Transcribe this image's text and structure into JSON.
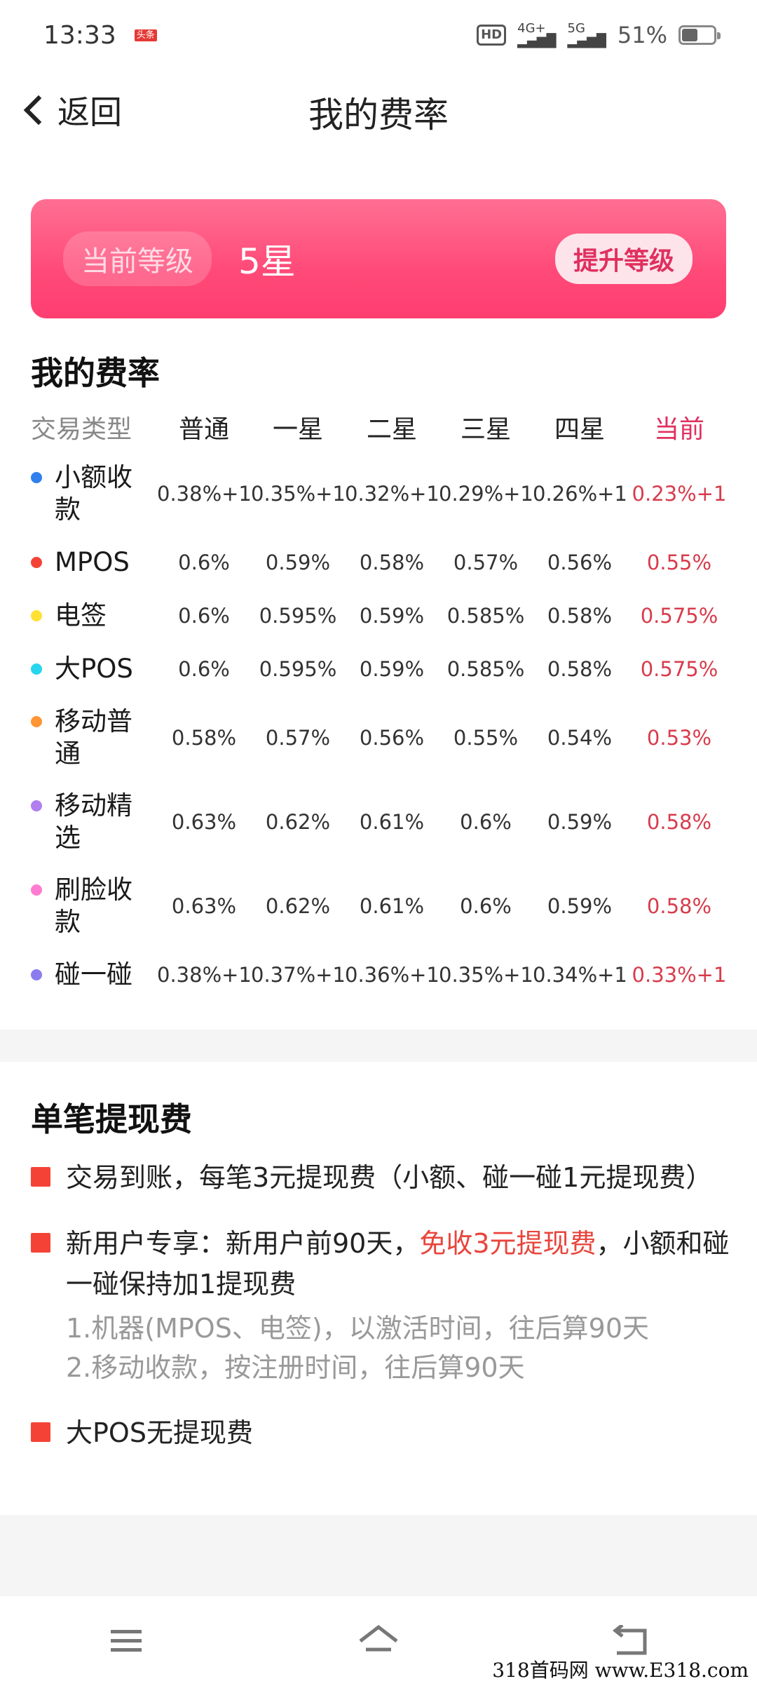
{
  "status_bar": {
    "time": "13:33",
    "news_badge": "头条",
    "network_1": "4G+",
    "network_2": "5G",
    "hd_label": "HD",
    "battery": "51%",
    "battery_level": 0.51
  },
  "nav": {
    "back_label": "返回",
    "title": "我的费率"
  },
  "level_card": {
    "tag_label": "当前等级",
    "level_value": "5星",
    "upgrade_label": "提升等级"
  },
  "rates": {
    "title": "我的费率",
    "headers": [
      "交易类型",
      "普通",
      "一星",
      "二星",
      "三星",
      "四星",
      "当前"
    ],
    "rows": [
      {
        "type": "小额收款",
        "color": "#2f80ed",
        "values": [
          "0.38%+1",
          "0.35%+1",
          "0.32%+1",
          "0.29%+1",
          "0.26%+1"
        ],
        "current": "0.23%+1"
      },
      {
        "type": "MPOS",
        "color": "#f44336",
        "values": [
          "0.6%",
          "0.59%",
          "0.58%",
          "0.57%",
          "0.56%"
        ],
        "current": "0.55%"
      },
      {
        "type": "电签",
        "color": "#ffe034",
        "values": [
          "0.6%",
          "0.595%",
          "0.59%",
          "0.585%",
          "0.58%"
        ],
        "current": "0.575%"
      },
      {
        "type": "大POS",
        "color": "#28d5ee",
        "values": [
          "0.6%",
          "0.595%",
          "0.59%",
          "0.585%",
          "0.58%"
        ],
        "current": "0.575%"
      },
      {
        "type": "移动普通",
        "color": "#ff9533",
        "values": [
          "0.58%",
          "0.57%",
          "0.56%",
          "0.55%",
          "0.54%"
        ],
        "current": "0.53%"
      },
      {
        "type": "移动精选",
        "color": "#b07ff0",
        "values": [
          "0.63%",
          "0.62%",
          "0.61%",
          "0.6%",
          "0.59%"
        ],
        "current": "0.58%"
      },
      {
        "type": "刷脸收款",
        "color": "#ff7bd0",
        "values": [
          "0.63%",
          "0.62%",
          "0.61%",
          "0.6%",
          "0.59%"
        ],
        "current": "0.58%"
      },
      {
        "type": "碰一碰",
        "color": "#8a7cf0",
        "values": [
          "0.38%+1",
          "0.37%+1",
          "0.36%+1",
          "0.35%+1",
          "0.34%+1"
        ],
        "current": "0.33%+1"
      }
    ]
  },
  "withdrawal": {
    "title": "单笔提现费",
    "item1": "交易到账，每笔3元提现费（小额、碰一碰1元提现费）",
    "item2_pre": "新用户专享：新用户前90天，",
    "item2_highlight": "免收3元提现费",
    "item2_post": "，小额和碰一碰保持加1提现费",
    "item2_sub1": "1.机器(MPOS、电签)，以激活时间，往后算90天",
    "item2_sub2": "2.移动收款，按注册时间，往后算90天",
    "item3": "大POS无提现费"
  },
  "watermark": "318首码网 www.E318.com"
}
